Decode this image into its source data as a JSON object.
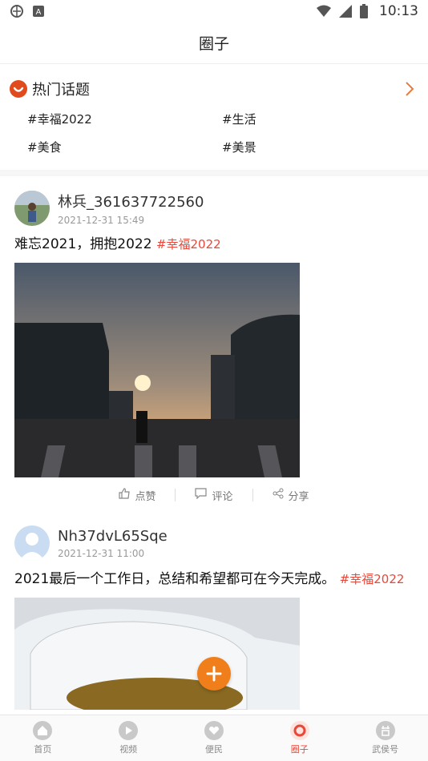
{
  "status_bar": {
    "time": "10:13"
  },
  "header": {
    "title": "圈子"
  },
  "hot_topics": {
    "title": "热门话题",
    "tags": [
      "#幸福2022",
      "#生活",
      "#美食",
      "#美景"
    ]
  },
  "posts": [
    {
      "author": "林兵_361637722560",
      "time": "2021-12-31 15:49",
      "text": "难忘2021，拥抱2022 ",
      "hashtag": "#幸福2022"
    },
    {
      "author": "Nh37dvL65Sqe",
      "time": "2021-12-31 11:00",
      "text": "2021最后一个工作日，总结和希望都可在今天完成。 ",
      "hashtag": "#幸福2022"
    }
  ],
  "actions": {
    "like": "点赞",
    "comment": "评论",
    "share": "分享"
  },
  "nav": [
    {
      "label": "首页",
      "icon": "home-icon"
    },
    {
      "label": "视频",
      "icon": "play-icon"
    },
    {
      "label": "便民",
      "icon": "heart-icon"
    },
    {
      "label": "圈子",
      "icon": "circle-icon"
    },
    {
      "label": "武侯号",
      "icon": "media-icon"
    }
  ],
  "colors": {
    "accent": "#e8483a",
    "fab": "#f07e1a"
  }
}
